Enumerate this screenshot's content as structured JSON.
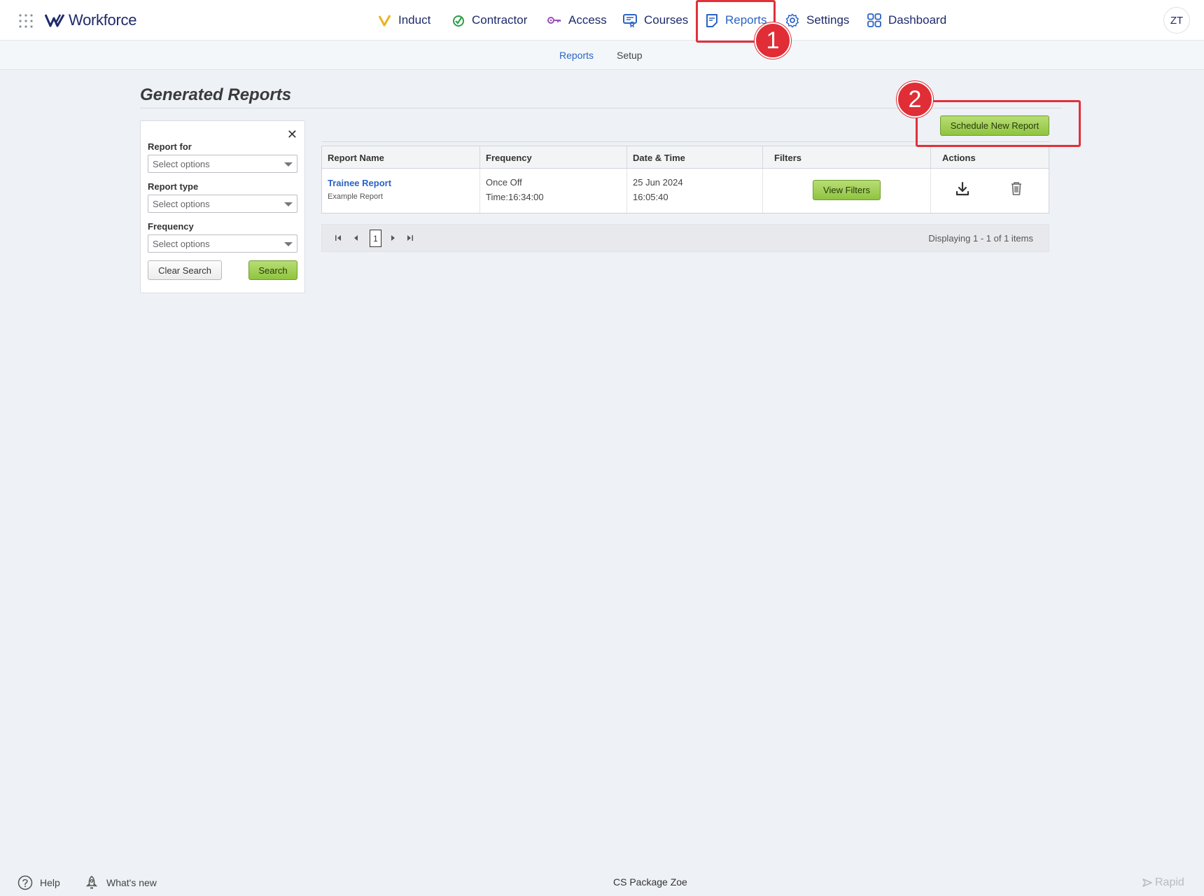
{
  "brand": {
    "name": "Workforce"
  },
  "nav": [
    {
      "label": "Induct",
      "icon": "induct-v-icon",
      "color": "#e8b420"
    },
    {
      "label": "Contractor",
      "icon": "contractor-check-icon",
      "color": "#2e9e48"
    },
    {
      "label": "Access",
      "icon": "access-key-icon",
      "color": "#9b4fb9"
    },
    {
      "label": "Courses",
      "icon": "courses-certificate-icon",
      "color": "#2a64c5"
    },
    {
      "label": "Reports",
      "icon": "reports-document-icon",
      "color": "#2a64c5",
      "active": true
    },
    {
      "label": "Settings",
      "icon": "settings-gear-icon",
      "color": "#2a64c5"
    },
    {
      "label": "Dashboard",
      "icon": "dashboard-grid-icon",
      "color": "#2a64c5"
    }
  ],
  "user": {
    "initials": "ZT"
  },
  "subnav": [
    {
      "label": "Reports",
      "active": true
    },
    {
      "label": "Setup"
    }
  ],
  "page": {
    "title": "Generated Reports"
  },
  "filters": {
    "report_for": {
      "label": "Report for",
      "placeholder": "Select options"
    },
    "report_type": {
      "label": "Report type",
      "placeholder": "Select options"
    },
    "frequency": {
      "label": "Frequency",
      "placeholder": "Select options"
    },
    "clear_label": "Clear Search",
    "search_label": "Search",
    "close_glyph": "✕"
  },
  "schedule_button": "Schedule New Report",
  "table": {
    "columns": [
      "Report Name",
      "Frequency",
      "Date & Time",
      "Filters",
      "Actions"
    ],
    "rows": [
      {
        "name": "Trainee Report",
        "subtitle": "Example Report",
        "frequency": "Once Off",
        "time": "Time:16:34:00",
        "date": "25 Jun 2024",
        "date_time": "16:05:40",
        "filters_button": "View Filters"
      }
    ]
  },
  "pager": {
    "current_page": "1",
    "info": "Displaying 1 - 1 of 1 items"
  },
  "annotations": {
    "badge1": "1",
    "badge2": "2",
    "color": "#e0313a"
  },
  "footer": {
    "help": "Help",
    "whats_new": "What's new",
    "center": "CS Package Zoe",
    "brand": "Rapid"
  },
  "colors": {
    "accent": "#2a64c5",
    "brand_navy": "#1f2a6b",
    "button_green": "#8fc43f"
  }
}
